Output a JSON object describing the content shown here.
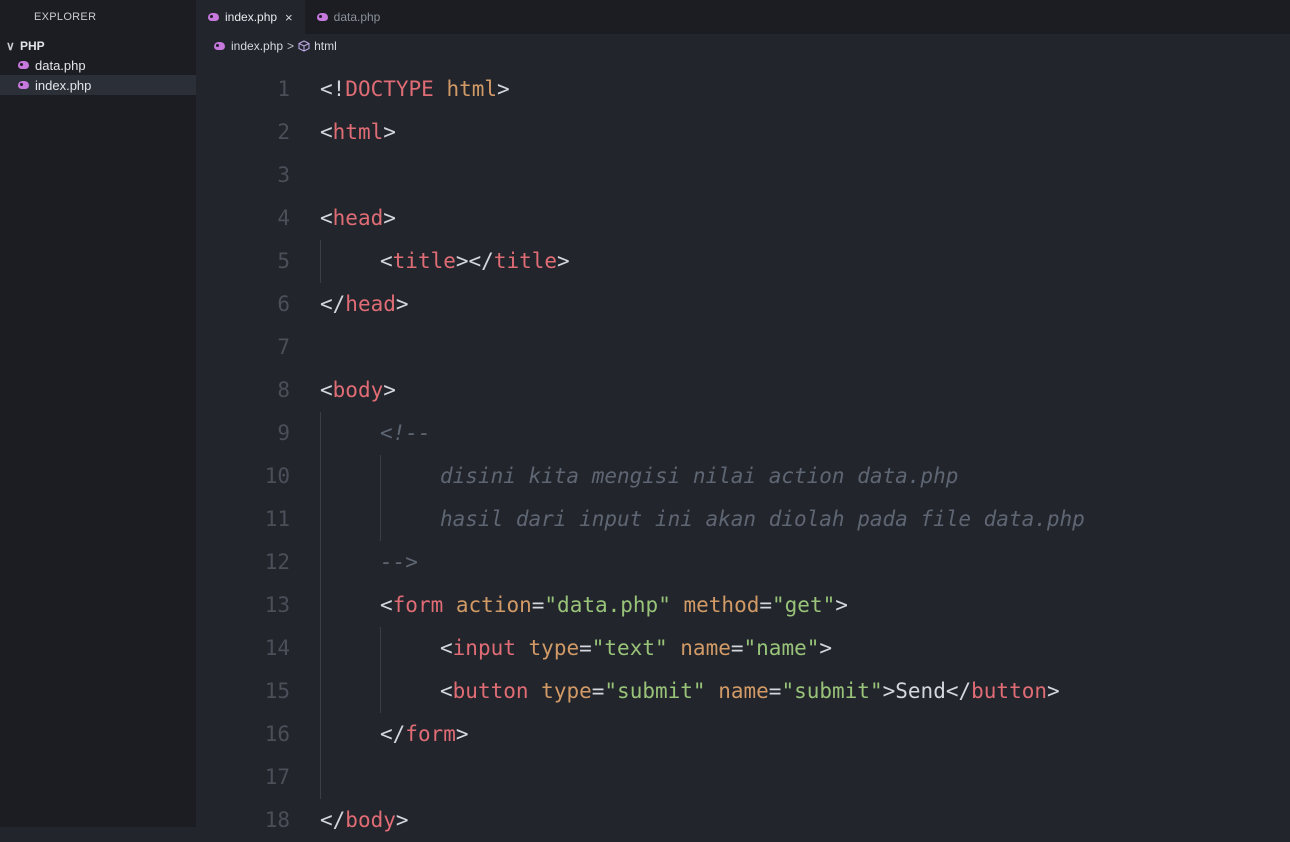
{
  "sidebar": {
    "title": "EXPLORER",
    "folder": "PHP",
    "files": [
      {
        "name": "data.php",
        "active": false
      },
      {
        "name": "index.php",
        "active": true
      }
    ]
  },
  "tabs": [
    {
      "label": "index.php",
      "active": true,
      "close": "×"
    },
    {
      "label": "data.php",
      "active": false
    }
  ],
  "breadcrumb": {
    "file": "index.php",
    "sep": ">",
    "symbol": "html"
  },
  "editor": {
    "lines": [
      {
        "n": "1",
        "indent": 0,
        "tokens": [
          [
            "punct",
            "<!"
          ],
          [
            "tag",
            "DOCTYPE"
          ],
          [
            "punct",
            " "
          ],
          [
            "attr",
            "html"
          ],
          [
            "punct",
            ">"
          ]
        ]
      },
      {
        "n": "2",
        "indent": 0,
        "tokens": [
          [
            "punct",
            "<"
          ],
          [
            "tag",
            "html"
          ],
          [
            "punct",
            ">"
          ]
        ]
      },
      {
        "n": "3",
        "indent": 0,
        "tokens": []
      },
      {
        "n": "4",
        "indent": 0,
        "tokens": [
          [
            "punct",
            "<"
          ],
          [
            "tag",
            "head"
          ],
          [
            "punct",
            ">"
          ]
        ]
      },
      {
        "n": "5",
        "indent": 1,
        "tokens": [
          [
            "punct",
            "<"
          ],
          [
            "tag",
            "title"
          ],
          [
            "punct",
            "></"
          ],
          [
            "tag",
            "title"
          ],
          [
            "punct",
            ">"
          ]
        ]
      },
      {
        "n": "6",
        "indent": 0,
        "tokens": [
          [
            "punct",
            "</"
          ],
          [
            "tag",
            "head"
          ],
          [
            "punct",
            ">"
          ]
        ]
      },
      {
        "n": "7",
        "indent": 0,
        "tokens": []
      },
      {
        "n": "8",
        "indent": 0,
        "tokens": [
          [
            "punct",
            "<"
          ],
          [
            "tag",
            "body"
          ],
          [
            "punct",
            ">"
          ]
        ]
      },
      {
        "n": "9",
        "indent": 1,
        "tokens": [
          [
            "cmt",
            "<!--"
          ]
        ]
      },
      {
        "n": "10",
        "indent": 2,
        "tokens": [
          [
            "cmt",
            "disini kita mengisi nilai action data.php"
          ]
        ]
      },
      {
        "n": "11",
        "indent": 2,
        "tokens": [
          [
            "cmt",
            "hasil dari input ini akan diolah pada file data.php"
          ]
        ]
      },
      {
        "n": "12",
        "indent": 1,
        "tokens": [
          [
            "cmt",
            "-->"
          ]
        ]
      },
      {
        "n": "13",
        "indent": 1,
        "tokens": [
          [
            "punct",
            "<"
          ],
          [
            "tag",
            "form"
          ],
          [
            "punct",
            " "
          ],
          [
            "attr",
            "action"
          ],
          [
            "punct",
            "="
          ],
          [
            "str",
            "\"data.php\""
          ],
          [
            "punct",
            " "
          ],
          [
            "attr",
            "method"
          ],
          [
            "punct",
            "="
          ],
          [
            "str",
            "\"get\""
          ],
          [
            "punct",
            ">"
          ]
        ]
      },
      {
        "n": "14",
        "indent": 2,
        "tokens": [
          [
            "punct",
            "<"
          ],
          [
            "tag",
            "input"
          ],
          [
            "punct",
            " "
          ],
          [
            "attr",
            "type"
          ],
          [
            "punct",
            "="
          ],
          [
            "str",
            "\"text\""
          ],
          [
            "punct",
            " "
          ],
          [
            "attr",
            "name"
          ],
          [
            "punct",
            "="
          ],
          [
            "str",
            "\"name\""
          ],
          [
            "punct",
            ">"
          ]
        ]
      },
      {
        "n": "15",
        "indent": 2,
        "tokens": [
          [
            "punct",
            "<"
          ],
          [
            "tag",
            "button"
          ],
          [
            "punct",
            " "
          ],
          [
            "attr",
            "type"
          ],
          [
            "punct",
            "="
          ],
          [
            "str",
            "\"submit\""
          ],
          [
            "punct",
            " "
          ],
          [
            "attr",
            "name"
          ],
          [
            "punct",
            "="
          ],
          [
            "str",
            "\"submit\""
          ],
          [
            "punct",
            ">"
          ],
          [
            "text",
            "Send"
          ],
          [
            "punct",
            "</"
          ],
          [
            "tag",
            "button"
          ],
          [
            "punct",
            ">"
          ]
        ]
      },
      {
        "n": "16",
        "indent": 1,
        "tokens": [
          [
            "punct",
            "</"
          ],
          [
            "tag",
            "form"
          ],
          [
            "punct",
            ">"
          ]
        ]
      },
      {
        "n": "17",
        "indent": 0,
        "tokens": []
      },
      {
        "n": "18",
        "indent": 0,
        "tokens": [
          [
            "punct",
            "</"
          ],
          [
            "tag",
            "body"
          ],
          [
            "punct",
            ">"
          ]
        ]
      }
    ]
  }
}
